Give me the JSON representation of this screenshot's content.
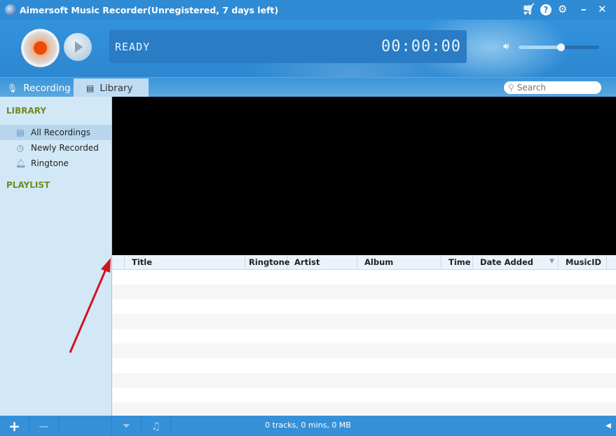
{
  "window": {
    "title": "Aimersoft Music Recorder(Unregistered, 7 days left)"
  },
  "player": {
    "status": "READY",
    "time": "00:00:00",
    "volume_percent": 52
  },
  "tabs": [
    {
      "label": "Recording"
    },
    {
      "label": "Library"
    }
  ],
  "search": {
    "placeholder": "Search"
  },
  "sidebar": {
    "library_heading": "LIBRARY",
    "items": [
      {
        "label": "All Recordings"
      },
      {
        "label": "Newly Recorded"
      },
      {
        "label": "Ringtone"
      }
    ],
    "playlist_heading": "PLAYLIST"
  },
  "table": {
    "columns": [
      "Title",
      "Ringtone",
      "Artist",
      "Album",
      "Time",
      "Date Added",
      "MusicID"
    ],
    "rows": []
  },
  "footer": {
    "stats": "0 tracks, 0 mins, 0 MB"
  },
  "colors": {
    "accent": "#2f8bd4",
    "sidebar": "#d3e8f7",
    "section": "#6f8c1e",
    "annotation": "#d0161b"
  }
}
